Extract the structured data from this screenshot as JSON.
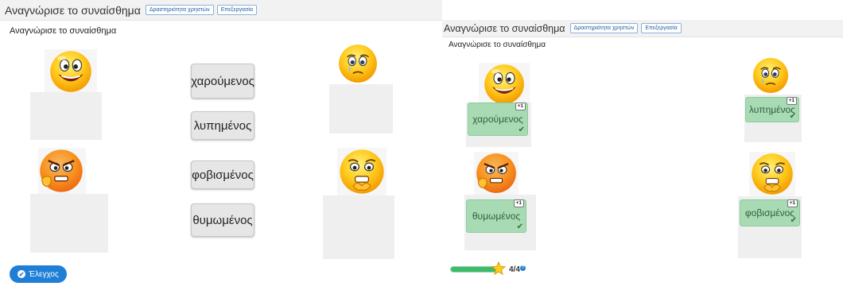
{
  "left": {
    "header": {
      "title": "Αναγνώρισε το συναίσθημα",
      "user_activity_button": "Δραστηριότητα χρηστών",
      "edit_button": "Επεξεργασία"
    },
    "subtitle": "Αναγνώρισε το συναίσθημα",
    "words": [
      "χαρούμενος",
      "λυπημένος",
      "φοβισμένος",
      "θυμωμένος"
    ],
    "emoji_icons": [
      "happy-face-icon",
      "sad-face-icon",
      "angry-face-icon",
      "scared-face-icon"
    ],
    "check_button": "Έλεγχος"
  },
  "right": {
    "header": {
      "title": "Αναγνώρισε το συναίσθημα",
      "user_activity_button": "Δραστηριότητα χρηστών",
      "edit_button": "Επεξεργασία"
    },
    "subtitle": "Αναγνώρισε το συναίσθημα",
    "placed": [
      {
        "emoji": "happy-face-icon",
        "word": "χαρούμενος",
        "points": "+1"
      },
      {
        "emoji": "sad-face-icon",
        "word": "λυπημένος",
        "points": "+1"
      },
      {
        "emoji": "angry-face-icon",
        "word": "θυμωμένος",
        "points": "+1"
      },
      {
        "emoji": "scared-face-icon",
        "word": "φοβισμένος",
        "points": "+1"
      }
    ],
    "progress": {
      "fraction": 1.0,
      "score": "4/4"
    }
  },
  "colors": {
    "accent": "#1f7fd6",
    "correct_green": "#a8dbb4",
    "progress_green": "#3dbb6a"
  }
}
